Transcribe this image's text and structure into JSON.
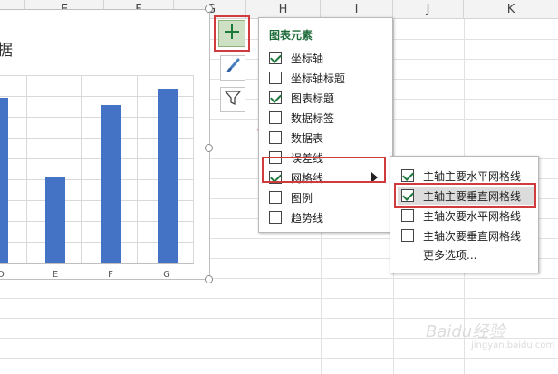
{
  "columns": [
    "E",
    "F",
    "G",
    "H",
    "I",
    "J",
    "K"
  ],
  "chart": {
    "title_fragment": "据",
    "x_labels": [
      "D",
      "E",
      "F",
      "G"
    ],
    "bar_color": "#4472c4"
  },
  "chart_data": {
    "type": "bar",
    "categories": [
      "D",
      "E",
      "F",
      "G"
    ],
    "values": [
      0.88,
      0.46,
      0.84,
      0.93
    ],
    "ylim": [
      0,
      1
    ]
  },
  "panel": {
    "title": "图表元素",
    "items": [
      {
        "label": "坐标轴",
        "checked": true
      },
      {
        "label": "坐标轴标题",
        "checked": false
      },
      {
        "label": "图表标题",
        "checked": true
      },
      {
        "label": "数据标签",
        "checked": false
      },
      {
        "label": "数据表",
        "checked": false
      },
      {
        "label": "误差线",
        "checked": false
      },
      {
        "label": "网格线",
        "checked": true
      },
      {
        "label": "图例",
        "checked": false
      },
      {
        "label": "趋势线",
        "checked": false
      }
    ]
  },
  "submenu": {
    "items": [
      {
        "label": "主轴主要水平网格线",
        "checked": true
      },
      {
        "label": "主轴主要垂直网格线",
        "checked": true
      },
      {
        "label": "主轴次要水平网格线",
        "checked": false
      },
      {
        "label": "主轴次要垂直网格线",
        "checked": false
      }
    ],
    "more": "更多选项..."
  },
  "icons": {
    "plus": "chart-elements-plus-icon",
    "brush": "chart-styles-brush-icon",
    "filter": "chart-filters-funnel-icon"
  },
  "watermark": "Baidu经验",
  "watermark_url": "jingyan.baidu.com"
}
